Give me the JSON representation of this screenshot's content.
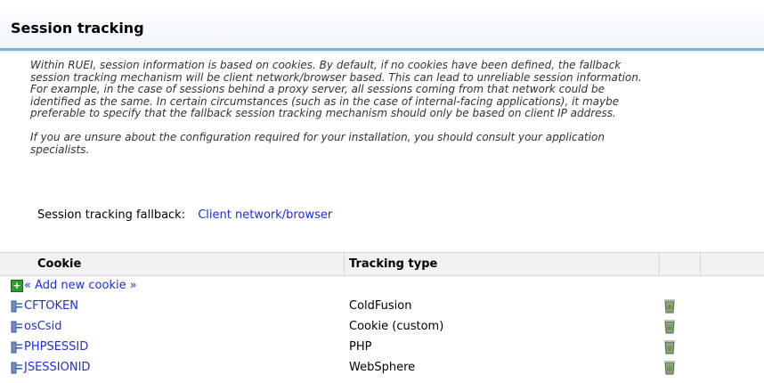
{
  "header": {
    "title": "Session tracking"
  },
  "description": {
    "lines": [
      "Within RUEI, session information is based on cookies. By default, if no cookies have been defined, the fallback",
      "session tracking mechanism will be client network/browser based. This can lead to unreliable session information.",
      "For example, in the case of sessions behind a proxy server, all sessions coming from that network could be",
      "identified as the same. In certain circumstances (such as in the case of internal-facing applications), it maybe",
      "preferable to specify that the fallback session tracking mechanism should only be based on client IP address."
    ],
    "lines2": [
      "If you are unsure about the configuration required for your installation, you should consult your application",
      "specialists."
    ]
  },
  "fallback": {
    "label": "Session tracking fallback:",
    "value": "Client network/browser"
  },
  "table": {
    "columns": [
      "Cookie",
      "Tracking type"
    ],
    "add_label": "« Add new cookie »",
    "rows": [
      {
        "cookie": "CFTOKEN",
        "type": "ColdFusion"
      },
      {
        "cookie": "osCsid",
        "type": "Cookie (custom)"
      },
      {
        "cookie": "PHPSESSID",
        "type": "PHP"
      },
      {
        "cookie": "JSESSIONID",
        "type": "WebSphere"
      }
    ]
  }
}
